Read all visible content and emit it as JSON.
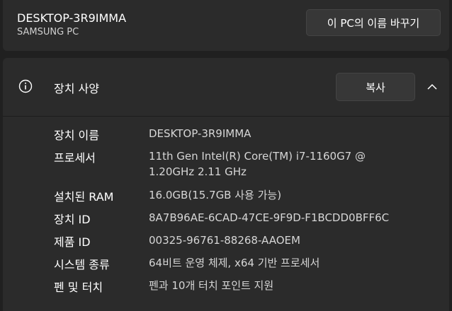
{
  "device": {
    "name": "DESKTOP-3R9IMMA",
    "model": "SAMSUNG PC",
    "rename_label": "이 PC의 이름 바꾸기"
  },
  "specs": {
    "title": "장치 사양",
    "copy_label": "복사",
    "rows": [
      {
        "label": "장치 이름",
        "value": "DESKTOP-3R9IMMA"
      },
      {
        "label": "프로세서",
        "value": "11th Gen Intel(R) Core(TM) i7-1160G7 @ 1.20GHz   2.11 GHz"
      },
      {
        "label": "설치된 RAM",
        "value": "16.0GB(15.7GB 사용 가능)"
      },
      {
        "label": "장치 ID",
        "value": "8A7B96AE-6CAD-47CE-9F9D-F1BCDD0BFF6C"
      },
      {
        "label": "제품 ID",
        "value": "00325-96761-88268-AAOEM"
      },
      {
        "label": "시스템 종류",
        "value": "64비트 운영 체제, x64 기반 프로세서"
      },
      {
        "label": "펜 및 터치",
        "value": "펜과 10개 터치 포인트 지원"
      }
    ]
  },
  "icons": {
    "info": "info-icon",
    "collapse": "chevron-up-icon"
  }
}
